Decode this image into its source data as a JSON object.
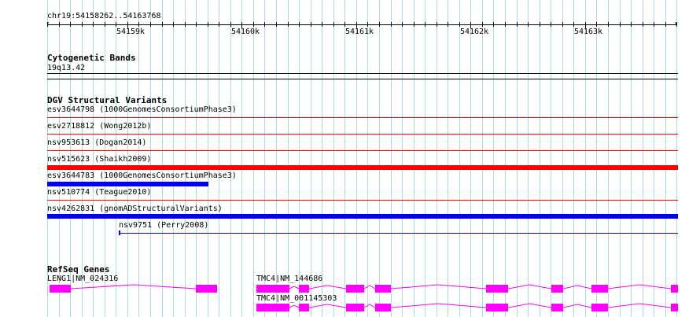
{
  "region": {
    "label": "chr19:54158262..54163768"
  },
  "ruler": {
    "ticks": [
      "54159k",
      "54160k",
      "54161k",
      "54162k",
      "54163k"
    ]
  },
  "tracks": {
    "cytoband": {
      "title": "Cytogenetic Bands",
      "band_label": "19q13.42"
    },
    "dgv": {
      "title": "DGV Structural Variants",
      "variants": [
        {
          "label": "esv3644798 (1000GenomesConsortiumPhase3)",
          "color": "#ff0000",
          "style": "thin"
        },
        {
          "label": "esv2718812 (Wong2012b)",
          "color": "#ff0000",
          "style": "thin"
        },
        {
          "label": "nsv953613 (Dogan2014)",
          "color": "#ff0000",
          "style": "thin"
        },
        {
          "label": "nsv515623 (Shaikh2009)",
          "color": "#ff0000",
          "style": "thick"
        },
        {
          "label": "esv3644783 (1000GenomesConsortiumPhase3)",
          "color": "#0000ff",
          "style": "thick"
        },
        {
          "label": "nsv510774 (Teague2010)",
          "color": "#ff0000",
          "style": "thin"
        },
        {
          "label": "nsv4262831 (gnomADStructuralVariants)",
          "color": "#0000ff",
          "style": "thick"
        },
        {
          "label": "nsv9751 (Perry2008)",
          "color": "#0000ff",
          "style": "thin"
        }
      ]
    },
    "refseq": {
      "title": "RefSeq Genes",
      "exon_color": "#ff00ff",
      "genes": [
        {
          "label": "LENG1|NM_024316"
        },
        {
          "label": "TMC4|NM_144686"
        },
        {
          "label": "TMC4|NM_001145303"
        }
      ]
    }
  },
  "colors": {
    "grid": "#add8e6",
    "axis": "#000000"
  }
}
